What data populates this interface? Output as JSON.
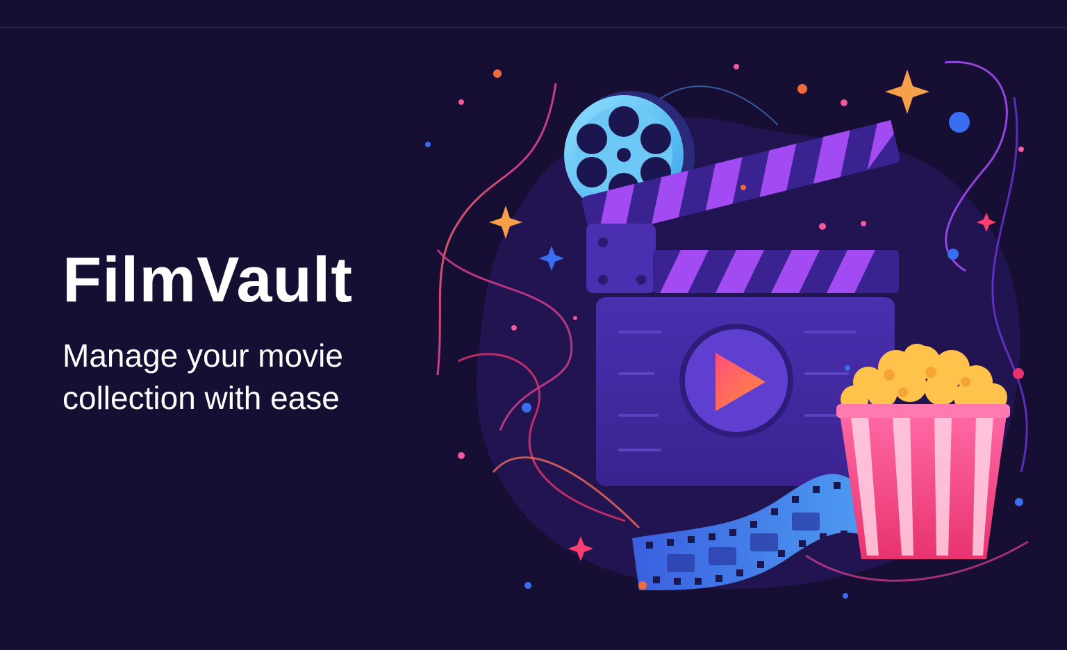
{
  "app": {
    "title": "FilmVault",
    "tagline_line1": "Manage your movie",
    "tagline_line2": "collection with ease"
  },
  "colors": {
    "background": "#160f33",
    "accent_purple": "#8b3ff2",
    "accent_pink": "#f25a9c",
    "accent_orange": "#f08a3a",
    "accent_blue": "#4a8fe8"
  },
  "illustration": {
    "icons": [
      "film-reel-icon",
      "clapperboard-icon",
      "play-icon",
      "popcorn-icon",
      "film-strip-icon",
      "sparkle-icon"
    ]
  }
}
